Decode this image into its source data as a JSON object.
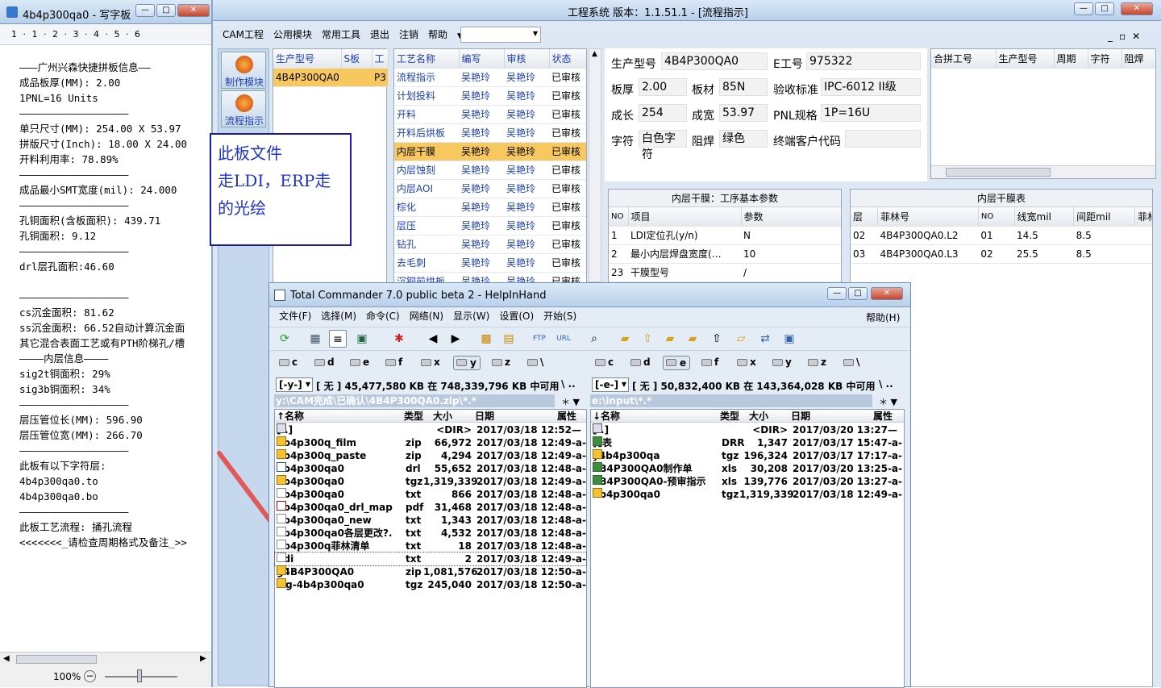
{
  "wordpad": {
    "title": "4b4p300qa0 - 写字板",
    "ruler": "1 · 1 · 2 · 3 · 4 · 5 · 6",
    "lines": [
      "———广州兴森快捷拼板信息——",
      "成品板厚(MM): 2.00",
      "1PNL=16 Units",
      "——————————————————",
      "单只尺寸(MM): 254.00 X 53.97",
      "拼版尺寸(Inch): 18.00 X 24.00",
      "开料利用率: 78.89%",
      "——————————————————",
      "成品最小SMT宽度(mil): 24.000",
      "——————————————————",
      "孔铜面积(含板面积): 439.71",
      "孔铜面积: 9.12",
      "——————————————————",
      "drl层孔面积:46.60",
      "",
      "——————————————————",
      "cs沉金面积: 81.62",
      "ss沉金面积: 66.52自动计算沉金面",
      "其它混合表面工艺或有PTH阶梯孔/槽",
      "————内层信息————",
      "sig2t铜面积: 29%",
      "sig3b铜面积: 34%",
      "——————————————————",
      "层压管位长(MM): 596.90",
      "层压管位宽(MM): 266.70",
      "——————————————————",
      "此板有以下字符层:",
      "4b4p300qa0.to",
      "4b4p300qa0.bo",
      "——————————————————",
      "此板工艺流程: 捅孔流程",
      "<<<<<<<_请检查周期格式及备注_>>"
    ],
    "zoom": "100%",
    "taskbar": "五 ·, ✎ ⌨ ✿ ♠"
  },
  "eng": {
    "title": "工程系统   版本：1.1.51.1 -  [流程指示]",
    "menu": [
      "CAM工程",
      "公用模块",
      "常用工具",
      "退出",
      "注销",
      "帮助"
    ],
    "side": [
      "制作模块",
      "流程指示"
    ],
    "prod_headers": [
      "生产型号",
      "S板",
      "工"
    ],
    "prod_row": [
      "4B4P300QA0",
      "P3"
    ],
    "step_headers": [
      "工艺名称",
      "编写",
      "审核",
      "状态"
    ],
    "steps": [
      [
        "流程指示",
        "吴艳玲",
        "吴艳玲",
        "已审核"
      ],
      [
        "计划投料",
        "吴艳玲",
        "吴艳玲",
        "已审核"
      ],
      [
        "开料",
        "吴艳玲",
        "吴艳玲",
        "已审核"
      ],
      [
        "开料后烘板",
        "吴艳玲",
        "吴艳玲",
        "已审核"
      ],
      [
        "内层干膜",
        "吴艳玲",
        "吴艳玲",
        "已审核"
      ],
      [
        "内层蚀刻",
        "吴艳玲",
        "吴艳玲",
        "已审核"
      ],
      [
        "内层AOI",
        "吴艳玲",
        "吴艳玲",
        "已审核"
      ],
      [
        "棕化",
        "吴艳玲",
        "吴艳玲",
        "已审核"
      ],
      [
        "层压",
        "吴艳玲",
        "吴艳玲",
        "已审核"
      ],
      [
        "钻孔",
        "吴艳玲",
        "吴艳玲",
        "已审核"
      ],
      [
        "去毛刺",
        "吴艳玲",
        "吴艳玲",
        "已审核"
      ],
      [
        "沉铜前烘板",
        "吴艳玲",
        "吴艳玲",
        "已审核"
      ]
    ],
    "info": {
      "model_l": "生产型号",
      "model": "4B4P300QA0",
      "e_l": "E工号",
      "e": "975322",
      "thick_l": "板厚",
      "thick": "2.00",
      "mat_l": "板材",
      "mat": "85N",
      "std_l": "验收标准",
      "std": "IPC-6012 II级",
      "len_l": "成长",
      "len": "254",
      "wid_l": "成宽",
      "wid": "53.97",
      "pnl_l": "PNL规格",
      "pnl": "1P=16U",
      "char_l": "字符",
      "char": "白色字符",
      "mask_l": "阻焊",
      "mask": "绿色",
      "cust_l": "终端客户代码",
      "cust": ""
    },
    "merge_headers": [
      "合拼工号",
      "生产型号",
      "周期",
      "字符",
      "阻焊"
    ],
    "param_title": "内层干膜：工序基本参数",
    "param_headers": [
      "NO",
      "项目",
      "参数"
    ],
    "params": [
      [
        "1",
        "LDI定位孔(y/n)",
        "N"
      ],
      [
        "2",
        "最小内层焊盘宽度(…",
        "10"
      ],
      [
        "23",
        "干膜型号",
        "/"
      ]
    ],
    "film_title": "内层干膜表",
    "film_headers": [
      "层",
      "菲林号",
      "NO",
      "线宽mil",
      "间距mil",
      "菲林线宽"
    ],
    "films": [
      [
        "02",
        "4B4P300QA0.L2",
        "01",
        "14.5",
        "8.5"
      ],
      [
        "03",
        "4B4P300QA0.L3",
        "02",
        "25.5",
        "8.5"
      ]
    ],
    "note": [
      "此板文件",
      "走LDI，ERP走",
      "的光绘"
    ]
  },
  "tc": {
    "title": "Total Commander 7.0 public beta 2 - HelpInHand",
    "menu": [
      "文件(F)",
      "选择(M)",
      "命令(C)",
      "网络(N)",
      "显示(W)",
      "设置(O)",
      "开始(S)"
    ],
    "help": "帮助(H)",
    "drives_l": [
      "c",
      "d",
      "e",
      "f",
      "x",
      "y",
      "z",
      "\\"
    ],
    "drives_r": [
      "c",
      "d",
      "e",
      "f",
      "x",
      "y",
      "z",
      "\\"
    ],
    "left": {
      "drive": "[-y-]",
      "free": "[ 无 ]  45,477,580 KB 在 748,339,796 KB 中可用",
      "path": "y:\\CAM完成\\已确认\\4B4P300QA0.zip\\*.*",
      "headers": [
        "↑名称",
        "类型",
        "大小",
        "日期",
        "属性"
      ],
      "files": [
        [
          "up",
          "[..]",
          "",
          "<DIR>",
          "2017/03/18 12:52—"
        ],
        [
          "zip",
          "4b4p300q_film",
          "zip",
          "66,972",
          "2017/03/18 12:49-a-"
        ],
        [
          "zip",
          "4b4p300q_paste",
          "zip",
          "4,294",
          "2017/03/18 12:49-a-"
        ],
        [
          "drl",
          "4b4p300qa0",
          "drl",
          "55,652",
          "2017/03/18 12:48-a-"
        ],
        [
          "zip",
          "4b4p300qa0",
          "tgz",
          "1,319,339",
          "2017/03/18 12:49-a-"
        ],
        [
          "txt",
          "4b4p300qa0",
          "txt",
          "866",
          "2017/03/18 12:48-a-"
        ],
        [
          "pdf",
          "4b4p300qa0_drl_map",
          "pdf",
          "31,468",
          "2017/03/18 12:48-a-"
        ],
        [
          "txt",
          "4b4p300qa0_new",
          "txt",
          "1,343",
          "2017/03/18 12:48-a-"
        ],
        [
          "txt",
          "4b4p300qa0各层更改?.",
          "txt",
          "4,532",
          "2017/03/18 12:48-a-"
        ],
        [
          "txt",
          "4b4p300q菲林清单",
          "txt",
          "18",
          "2017/03/18 12:48-a-"
        ],
        [
          "txt",
          "ddi",
          "txt",
          "2",
          "2017/03/18 12:49-a-"
        ],
        [
          "zip",
          "g4B4P300QA0",
          "zip",
          "1,081,576",
          "2017/03/18 12:50-a-"
        ],
        [
          "zip",
          "wg-4b4p300qa0",
          "tgz",
          "245,040",
          "2017/03/18 12:50-a-"
        ]
      ]
    },
    "right": {
      "drive": "[-e-]",
      "free": "[ 无 ]  50,832,400 KB 在 143,364,028 KB 中可用",
      "path": "e:\\input\\*.*",
      "headers": [
        "↓名称",
        "类型",
        "大小",
        "日期",
        "属性"
      ],
      "files": [
        [
          "up",
          "[..]",
          "",
          "<DIR>",
          "2017/03/20 13:27—"
        ],
        [
          "xls",
          "孔表",
          "DRR",
          "1,347",
          "2017/03/17 15:47-a-"
        ],
        [
          "zip",
          "y4b4p300qa",
          "tgz",
          "196,324",
          "2017/03/17 17:17-a-"
        ],
        [
          "xls",
          "4B4P300QA0制作单",
          "xls",
          "30,208",
          "2017/03/20 13:25-a-"
        ],
        [
          "xls",
          "4B4P300QA0-预审指示",
          "xls",
          "139,776",
          "2017/03/20 13:27-a-"
        ],
        [
          "zip",
          "4b4p300qa0",
          "tgz",
          "1,319,339",
          "2017/03/18 12:49-a-"
        ]
      ]
    }
  }
}
